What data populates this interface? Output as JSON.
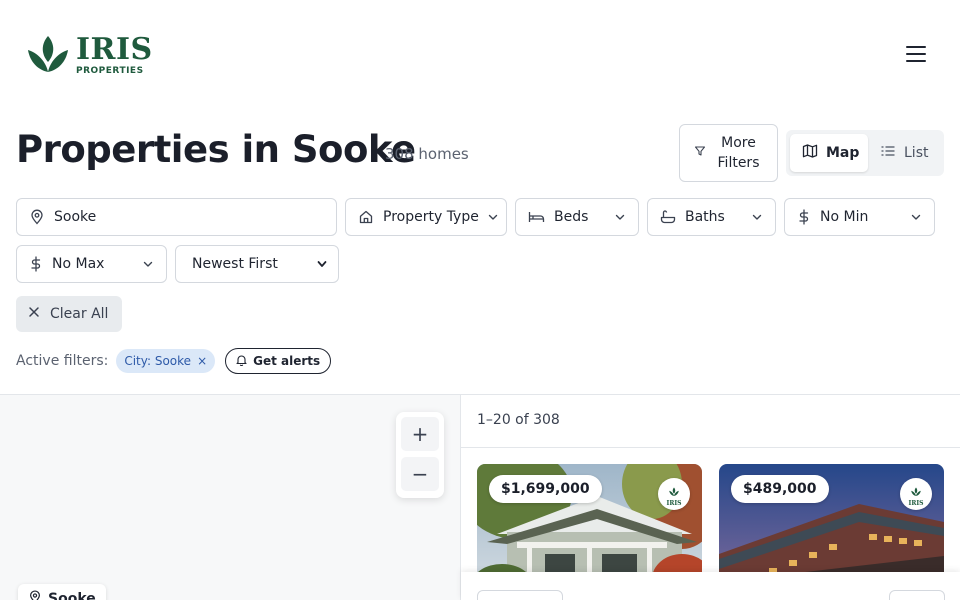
{
  "brand": {
    "name": "IRIS",
    "sub": "PROPERTIES",
    "color": "#1f5a3d"
  },
  "page": {
    "title": "Properties in Sooke",
    "count": "308 homes"
  },
  "toolbar": {
    "more_filters": "More Filters",
    "view": {
      "map": "Map",
      "list": "List",
      "selected": "Map"
    }
  },
  "filters": {
    "location": {
      "value": "Sooke",
      "icon": "map-pin-icon"
    },
    "property_type": {
      "label": "Property Type",
      "icon": "home-icon"
    },
    "beds": {
      "label": "Beds",
      "icon": "bed-icon"
    },
    "baths": {
      "label": "Baths",
      "icon": "bath-icon"
    },
    "min_price": {
      "label": "No Min",
      "icon": "dollar-icon"
    },
    "max_price": {
      "label": "No Max",
      "icon": "dollar-icon"
    },
    "sort": {
      "selected": "Newest First",
      "options": [
        "Newest First"
      ]
    },
    "clear_all": "Clear All"
  },
  "active_filters": {
    "label": "Active filters:",
    "chips": [
      {
        "label": "City: Sooke",
        "remove": "×"
      }
    ],
    "alerts_label": "Get alerts"
  },
  "map": {
    "zoom_in": "+",
    "zoom_out": "−",
    "place_label": "Sooke"
  },
  "results": {
    "range": "1–20 of 308",
    "listings": [
      {
        "price": "$1,699,000",
        "badge": "IRIS"
      },
      {
        "price": "$489,000",
        "badge": "IRIS"
      }
    ]
  },
  "colors": {
    "chip_bg": "#dbe8f8",
    "chip_text": "#2e5aa8",
    "accent": "#1f5a3d"
  }
}
